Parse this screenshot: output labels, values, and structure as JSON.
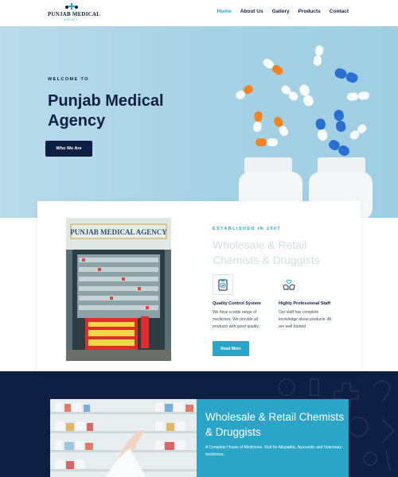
{
  "header": {
    "logo_text": "PUNJAB MEDICAL",
    "logo_sub": "AGENCY",
    "nav": [
      {
        "label": "Home",
        "active": true
      },
      {
        "label": "About Us",
        "active": false
      },
      {
        "label": "Gallery",
        "active": false
      },
      {
        "label": "Products",
        "active": false
      },
      {
        "label": "Contact",
        "active": false
      }
    ]
  },
  "hero": {
    "welcome": "WELCOME TO",
    "title": "Punjab Medical Agency",
    "button": "Who We Are",
    "image": "pills-and-bottles-image"
  },
  "about": {
    "photo": "storefront-photo",
    "sign_text": "PUNJAB MEDICAL AGENCY",
    "established": "ESTABLISHED IN 2007",
    "title": "Wholesale & Retail Chemists & Druggists",
    "features": [
      {
        "icon": "clipboard-check-icon",
        "title": "Quality Control System",
        "text": "We have a wide range of medicines. We provide all products with good quality."
      },
      {
        "icon": "hands-heart-icon",
        "title": "Highly Professional Staff",
        "text": "Our staff has complete knowledge about products. All are well trained."
      }
    ],
    "button": "Read More"
  },
  "banner": {
    "photo": "pharmacist-shelves-photo",
    "title": "Wholesale & Retail Chemists & Druggists",
    "text": "A Complete House of Medicines. Visit for Allopathic, Ayurvedic and Veterinary medicines."
  },
  "colors": {
    "navy": "#0f1f44",
    "accent": "#2aa5c8",
    "hero_bg": "#a6d2e5"
  }
}
